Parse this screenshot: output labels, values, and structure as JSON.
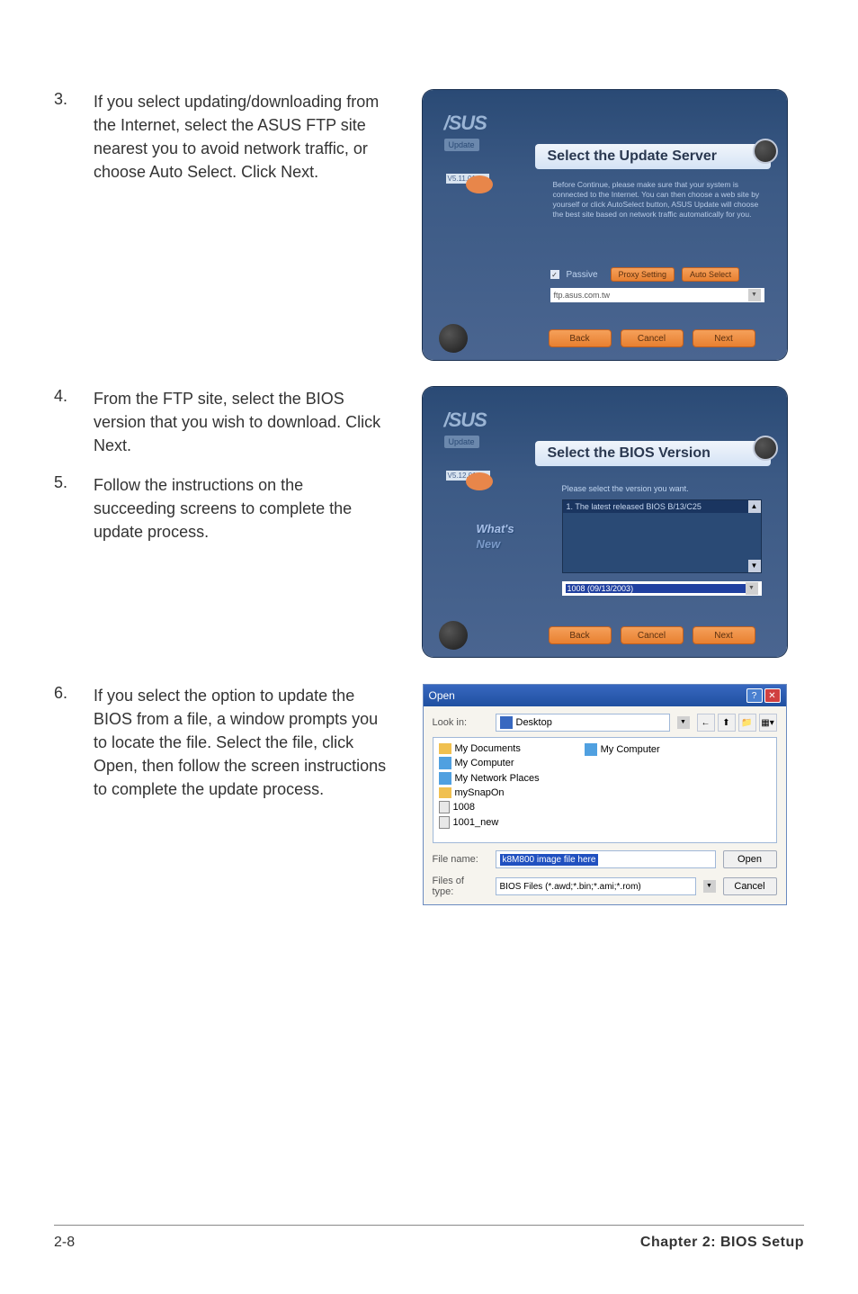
{
  "steps": {
    "s3": {
      "num": "3.",
      "text": "If you select updating/downloading from the Internet, select the ASUS FTP site nearest you to avoid network traffic, or choose Auto Select. Click Next."
    },
    "s4": {
      "num": "4.",
      "text": "From the FTP site, select the BIOS version that you wish to download. Click Next."
    },
    "s5": {
      "num": "5.",
      "text": "Follow the instructions on the succeeding screens to complete the update process."
    },
    "s6": {
      "num": "6.",
      "text": "If you select the option to update the BIOS from a file, a window prompts you to locate the file. Select the file, click Open, then follow the screen instructions to complete the update process."
    }
  },
  "dialog1": {
    "logo": "/SUS",
    "update": "Update",
    "version": "V5.11.01",
    "title": "Select the Update Server",
    "desc": "Before Continue, please make sure that your system is connected to the Internet. You can then choose a web site by yourself or click AutoSelect button, ASUS Update will choose the best site based on network traffic automatically for you.",
    "passive": "Passive",
    "proxy": "Proxy Setting",
    "auto": "Auto Select",
    "server": "ftp.asus.com.tw",
    "back": "Back",
    "cancel": "Cancel",
    "next": "Next"
  },
  "dialog2": {
    "logo": "/SUS",
    "update": "Update",
    "version": "V5.12.01",
    "title": "Select the BIOS Version",
    "desc": "Please select the version you want.",
    "listitem": "1. The latest released BIOS B/13/C25",
    "whats": "What's",
    "new": "New",
    "biosdate": "1008 (09/13/2003)",
    "back": "Back",
    "cancel": "Cancel",
    "next": "Next"
  },
  "open": {
    "title": "Open",
    "lookin_label": "Look in:",
    "lookin_value": "Desktop",
    "files_left": [
      "My Documents",
      "My Computer",
      "My Network Places",
      "mySnapOn",
      "1008",
      "1001_new"
    ],
    "files_right": [
      "My Computer"
    ],
    "filename_label": "File name:",
    "filename_value": "k8M800 image file here",
    "filetype_label": "Files of type:",
    "filetype_value": "BIOS Files (*.awd;*.bin;*.ami;*.rom)",
    "open_btn": "Open",
    "cancel_btn": "Cancel"
  },
  "footer": {
    "page": "2-8",
    "chapter": "Chapter 2: BIOS Setup"
  }
}
